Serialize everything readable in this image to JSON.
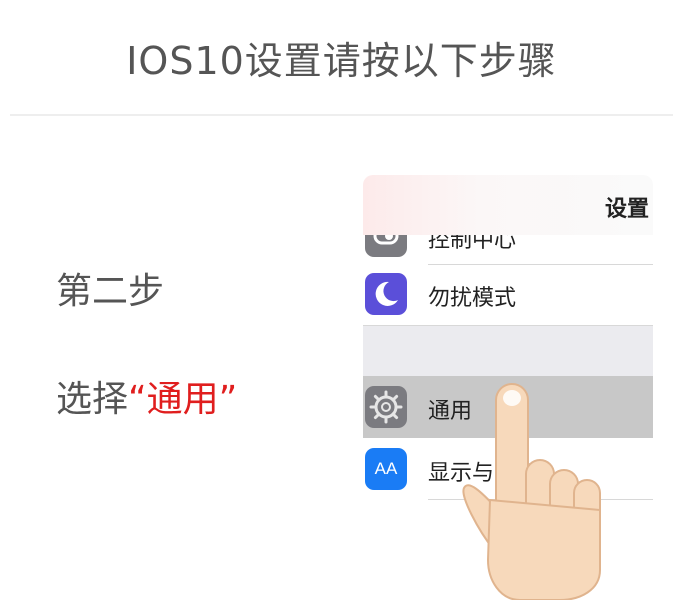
{
  "title": "IOS10设置请按以下步骤",
  "step": "第二步",
  "instruction": {
    "prefix": "选择",
    "highlight": "“通用”"
  },
  "settings": {
    "nav_title": "设置",
    "rows": [
      {
        "label": "控制中心",
        "icon": "control-center-icon"
      },
      {
        "label": "勿扰模式",
        "icon": "moon-icon"
      },
      {
        "label": "通用",
        "icon": "gear-icon"
      },
      {
        "label": "显示与亮度",
        "icon": "text-size-icon"
      }
    ],
    "text_size_glyph": "AA"
  },
  "colors": {
    "title_text": "#555555",
    "highlight": "#e01e1e",
    "dnd_icon": "#5b4fd9",
    "display_icon": "#1a7cf5",
    "general_row": "#c8c8c8"
  }
}
